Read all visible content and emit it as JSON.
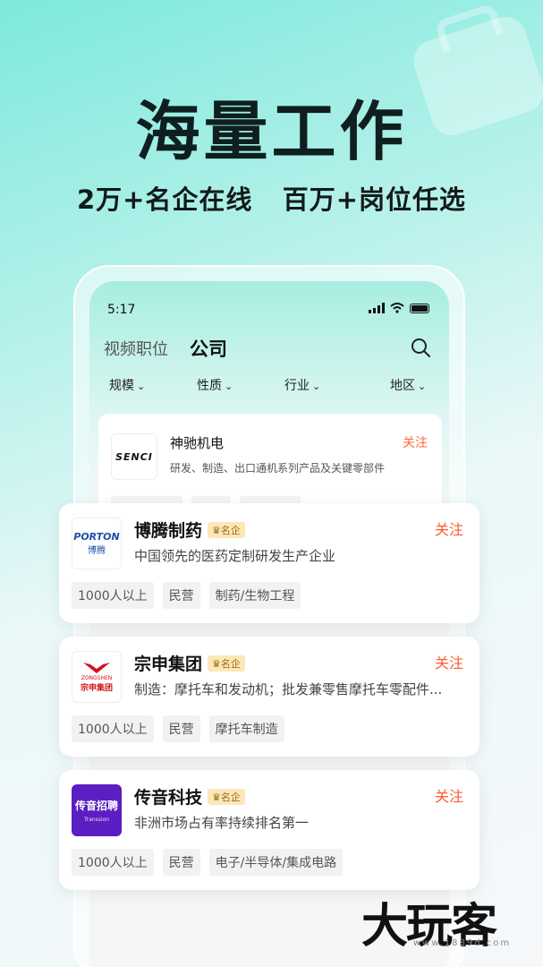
{
  "hero": {
    "title": "海量工作",
    "subtitle": "2万+名企在线   百万+岗位任选"
  },
  "phone": {
    "status_time": "5:17",
    "tabs": {
      "video": "视频职位",
      "company": "公司"
    },
    "filters": [
      "规模",
      "性质",
      "行业",
      "地区"
    ],
    "inner_card": {
      "logo_text": "SENCI",
      "name": "神驰机电",
      "desc": "研发、制造、出口通机系列产品及关键零部件",
      "follow": "关注"
    }
  },
  "badge_label": "名企",
  "companies": [
    {
      "name": "博腾制药",
      "logo_line1": "PORTON",
      "logo_line2": "博腾",
      "desc": "中国领先的医药定制研发生产企业",
      "follow": "关注",
      "tags": [
        "1000人以上",
        "民营",
        "制药/生物工程"
      ]
    },
    {
      "name": "宗申集团",
      "logo_line1": "ZONGSHEN",
      "logo_line2": "宗申集团",
      "desc": "制造：摩托车和发动机；批发兼零售摩托车零配件...",
      "follow": "关注",
      "tags": [
        "1000人以上",
        "民营",
        "摩托车制造"
      ]
    },
    {
      "name": "传音科技",
      "logo_line1": "传音招聘",
      "logo_line2": "Transsion",
      "desc": "非洲市场占有率持续排名第一",
      "follow": "关注",
      "tags": [
        "1000人以上",
        "民营",
        "电子/半导体/集成电路"
      ]
    }
  ],
  "watermark": {
    "text": "大玩客",
    "sub": "www.1889d.com"
  },
  "colors": {
    "follow": "#ff5a2e",
    "badge_bg": "#fbe7b8",
    "accent_teal": "#7ee9dc"
  }
}
